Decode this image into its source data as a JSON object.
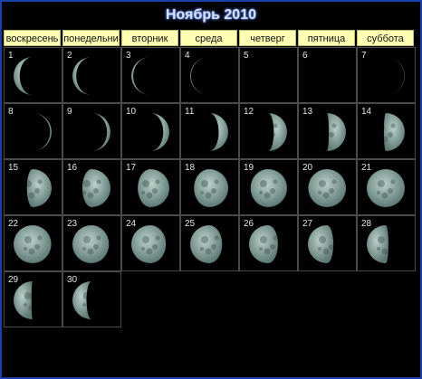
{
  "calendar": {
    "title": "Ноябрь 2010",
    "weekdays": [
      "воскресень",
      "понедельни",
      "вторник",
      "среда",
      "четверг",
      "пятница",
      "суббота"
    ],
    "days": [
      {
        "day": "1",
        "phase": 0.16,
        "waxing": false
      },
      {
        "day": "2",
        "phase": 0.1,
        "waxing": false
      },
      {
        "day": "3",
        "phase": 0.05,
        "waxing": false
      },
      {
        "day": "4",
        "phase": 0.02,
        "waxing": false
      },
      {
        "day": "5",
        "phase": 0.0,
        "waxing": true
      },
      {
        "day": "6",
        "phase": 0.0,
        "waxing": true
      },
      {
        "day": "7",
        "phase": 0.01,
        "waxing": true
      },
      {
        "day": "8",
        "phase": 0.04,
        "waxing": true
      },
      {
        "day": "9",
        "phase": 0.09,
        "waxing": true
      },
      {
        "day": "10",
        "phase": 0.16,
        "waxing": true
      },
      {
        "day": "11",
        "phase": 0.25,
        "waxing": true
      },
      {
        "day": "12",
        "phase": 0.35,
        "waxing": true
      },
      {
        "day": "13",
        "phase": 0.45,
        "waxing": true
      },
      {
        "day": "14",
        "phase": 0.55,
        "waxing": true
      },
      {
        "day": "15",
        "phase": 0.65,
        "waxing": true
      },
      {
        "day": "16",
        "phase": 0.74,
        "waxing": true
      },
      {
        "day": "17",
        "phase": 0.83,
        "waxing": true
      },
      {
        "day": "18",
        "phase": 0.9,
        "waxing": true
      },
      {
        "day": "19",
        "phase": 0.96,
        "waxing": true
      },
      {
        "day": "20",
        "phase": 0.99,
        "waxing": true
      },
      {
        "day": "21",
        "phase": 1.0,
        "waxing": false
      },
      {
        "day": "22",
        "phase": 0.99,
        "waxing": false
      },
      {
        "day": "23",
        "phase": 0.96,
        "waxing": false
      },
      {
        "day": "24",
        "phase": 0.91,
        "waxing": false
      },
      {
        "day": "25",
        "phase": 0.84,
        "waxing": false
      },
      {
        "day": "26",
        "phase": 0.76,
        "waxing": false
      },
      {
        "day": "27",
        "phase": 0.67,
        "waxing": false
      },
      {
        "day": "28",
        "phase": 0.57,
        "waxing": false
      },
      {
        "day": "29",
        "phase": 0.47,
        "waxing": false
      },
      {
        "day": "30",
        "phase": 0.37,
        "waxing": false
      }
    ],
    "colors": {
      "moon_light": "#9fb7b0",
      "moon_dark": "#4c6664",
      "border": "#1a3fa8",
      "header_bg": "#ffffb4"
    }
  }
}
